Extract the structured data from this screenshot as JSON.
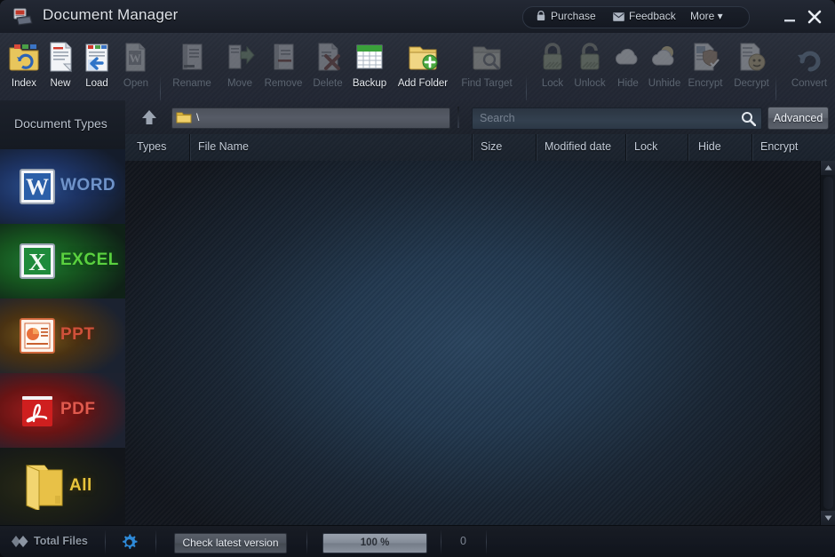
{
  "window": {
    "title": "Document Manager",
    "app_icon": "documents-icon",
    "buttons": {
      "purchase": "Purchase",
      "purchase_icon": "cart-icon",
      "feedback": "Feedback",
      "feedback_icon": "envelope-icon",
      "more": "More ▾",
      "minimize": "minimize-icon",
      "close": "close-icon"
    }
  },
  "toolbar": {
    "items": [
      {
        "label": "Index",
        "icon": "folder-refresh-icon",
        "enabled": true
      },
      {
        "label": "New",
        "icon": "new-document-icon",
        "enabled": true
      },
      {
        "label": "Load",
        "icon": "load-document-icon",
        "enabled": true
      },
      {
        "label": "Open",
        "icon": "open-word-icon",
        "enabled": false
      },
      {
        "label": "Rename",
        "icon": "rename-icon",
        "enabled": false
      },
      {
        "label": "Move",
        "icon": "move-icon",
        "enabled": false
      },
      {
        "label": "Remove",
        "icon": "remove-icon",
        "enabled": false
      },
      {
        "label": "Delete",
        "icon": "delete-icon",
        "enabled": false
      },
      {
        "label": "Backup",
        "icon": "backup-grid-icon",
        "enabled": true
      },
      {
        "label": "Add Folder",
        "icon": "add-folder-icon",
        "enabled": true
      },
      {
        "label": "Find Target",
        "icon": "find-target-icon",
        "enabled": false
      },
      {
        "label": "Lock",
        "icon": "lock-closed-icon",
        "enabled": false
      },
      {
        "label": "Unlock",
        "icon": "lock-open-icon",
        "enabled": false
      },
      {
        "label": "Hide",
        "icon": "cloud-icon",
        "enabled": false
      },
      {
        "label": "Unhide",
        "icon": "cloud-sun-icon",
        "enabled": false
      },
      {
        "label": "Encrypt",
        "icon": "encrypt-shield-icon",
        "enabled": false
      },
      {
        "label": "Decrypt",
        "icon": "decrypt-key-icon",
        "enabled": false
      },
      {
        "label": "Convert",
        "icon": "convert-arrow-icon",
        "enabled": false
      }
    ]
  },
  "sidebar": {
    "header": "Document Types",
    "items": [
      {
        "label": "WORD",
        "icon": "word-icon"
      },
      {
        "label": "EXCEL",
        "icon": "excel-icon"
      },
      {
        "label": "PPT",
        "icon": "powerpoint-icon"
      },
      {
        "label": "PDF",
        "icon": "pdf-icon"
      },
      {
        "label": "All",
        "icon": "folder-icon"
      }
    ]
  },
  "navbar": {
    "up_icon": "arrow-up-icon",
    "address_value": "\\",
    "address_icon": "folder-icon",
    "search_placeholder": "Search",
    "search_value": "",
    "search_icon": "magnifier-icon",
    "advanced_label": "Advanced"
  },
  "filelist": {
    "columns": [
      "Types",
      "File Name",
      "Size",
      "Modified date",
      "Lock",
      "Hide",
      "Encrypt"
    ],
    "rows": []
  },
  "statusbar": {
    "total_files_label": "Total Files",
    "total_files_icon": "diamonds-icon",
    "settings_icon": "gear-icon",
    "check_version_label": "Check latest version",
    "progress_text": "100 %",
    "progress_percent": 100,
    "file_count": "0"
  },
  "colors": {
    "accent": "#2a445e",
    "titlebar": "#232834",
    "toolbar": "#2a303c",
    "sidebar": "#14181f",
    "word": "#2b4f8e",
    "excel": "#1f7a33",
    "ppt": "#d0513a",
    "pdf": "#a01d1d",
    "all": "#e8c43c"
  }
}
